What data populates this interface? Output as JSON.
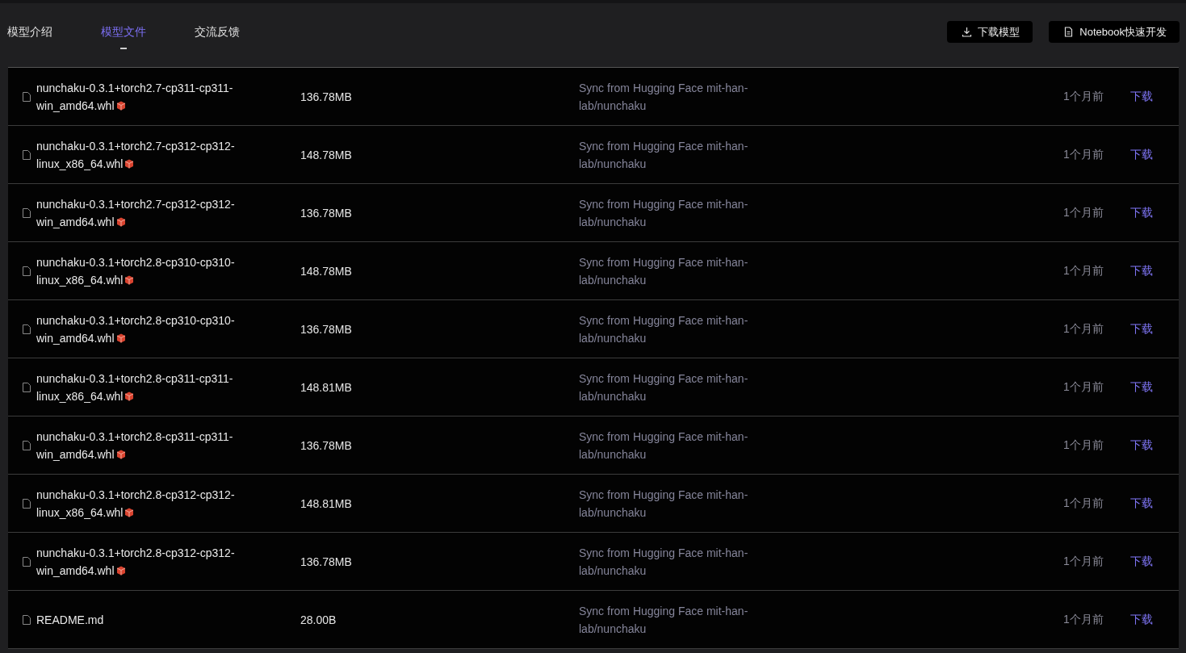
{
  "tabs": [
    {
      "label": "模型介绍",
      "selected": false
    },
    {
      "label": "模型文件",
      "selected": true
    },
    {
      "label": "交流反馈",
      "selected": false
    }
  ],
  "actions": [
    {
      "kind": "download",
      "label": "下载模型"
    },
    {
      "kind": "notebook",
      "label": "Notebook快速开发"
    }
  ],
  "files": [
    {
      "name": "nunchaku-0.3.1+torch2.7-cp311-cp311-win_amd64.whl",
      "package": true,
      "size": "136.78MB",
      "message": "Sync from Hugging Face mit-han-lab/nunchaku",
      "time": "1个月前",
      "action": "下载"
    },
    {
      "name": "nunchaku-0.3.1+torch2.7-cp312-cp312-linux_x86_64.whl",
      "package": true,
      "size": "148.78MB",
      "message": "Sync from Hugging Face mit-han-lab/nunchaku",
      "time": "1个月前",
      "action": "下载"
    },
    {
      "name": "nunchaku-0.3.1+torch2.7-cp312-cp312-win_amd64.whl",
      "package": true,
      "size": "136.78MB",
      "message": "Sync from Hugging Face mit-han-lab/nunchaku",
      "time": "1个月前",
      "action": "下载"
    },
    {
      "name": "nunchaku-0.3.1+torch2.8-cp310-cp310-linux_x86_64.whl",
      "package": true,
      "size": "148.78MB",
      "message": "Sync from Hugging Face mit-han-lab/nunchaku",
      "time": "1个月前",
      "action": "下载"
    },
    {
      "name": "nunchaku-0.3.1+torch2.8-cp310-cp310-win_amd64.whl",
      "package": true,
      "size": "136.78MB",
      "message": "Sync from Hugging Face mit-han-lab/nunchaku",
      "time": "1个月前",
      "action": "下载"
    },
    {
      "name": "nunchaku-0.3.1+torch2.8-cp311-cp311-linux_x86_64.whl",
      "package": true,
      "size": "148.81MB",
      "message": "Sync from Hugging Face mit-han-lab/nunchaku",
      "time": "1个月前",
      "action": "下载"
    },
    {
      "name": "nunchaku-0.3.1+torch2.8-cp311-cp311-win_amd64.whl",
      "package": true,
      "size": "136.78MB",
      "message": "Sync from Hugging Face mit-han-lab/nunchaku",
      "time": "1个月前",
      "action": "下载"
    },
    {
      "name": "nunchaku-0.3.1+torch2.8-cp312-cp312-linux_x86_64.whl",
      "package": true,
      "size": "148.81MB",
      "message": "Sync from Hugging Face mit-han-lab/nunchaku",
      "time": "1个月前",
      "action": "下载"
    },
    {
      "name": "nunchaku-0.3.1+torch2.8-cp312-cp312-win_amd64.whl",
      "package": true,
      "size": "136.78MB",
      "message": "Sync from Hugging Face mit-han-lab/nunchaku",
      "time": "1个月前",
      "action": "下载"
    },
    {
      "name": "README.md",
      "package": false,
      "size": "28.00B",
      "message": "Sync from Hugging Face mit-han-lab/nunchaku",
      "time": "1个月前",
      "action": "下载"
    }
  ]
}
